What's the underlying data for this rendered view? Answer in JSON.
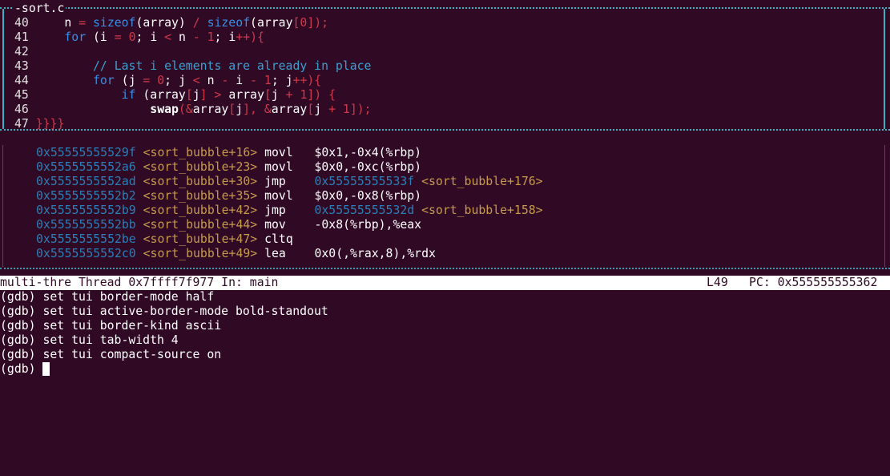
{
  "source_window": {
    "title": "sort.c",
    "lines": [
      {
        "num": "40",
        "tokens": [
          {
            "t": "    n ",
            "c": "c-text"
          },
          {
            "t": "= ",
            "c": "c-red"
          },
          {
            "t": "sizeof",
            "c": "c-kw"
          },
          {
            "t": "(array) ",
            "c": "c-text"
          },
          {
            "t": "/ ",
            "c": "c-red"
          },
          {
            "t": "sizeof",
            "c": "c-kw"
          },
          {
            "t": "(array",
            "c": "c-text"
          },
          {
            "t": "[",
            "c": "c-red"
          },
          {
            "t": "0",
            "c": "c-red"
          },
          {
            "t": "]",
            "c": "c-red"
          },
          {
            "t": ");",
            "c": "c-red"
          }
        ]
      },
      {
        "num": "41",
        "tokens": [
          {
            "t": "    ",
            "c": "c-text"
          },
          {
            "t": "for",
            "c": "c-kw"
          },
          {
            "t": " (i ",
            "c": "c-text"
          },
          {
            "t": "= ",
            "c": "c-red"
          },
          {
            "t": "0",
            "c": "c-red"
          },
          {
            "t": "; i ",
            "c": "c-text"
          },
          {
            "t": "< ",
            "c": "c-red"
          },
          {
            "t": "n ",
            "c": "c-text"
          },
          {
            "t": "- ",
            "c": "c-red"
          },
          {
            "t": "1",
            "c": "c-red"
          },
          {
            "t": "; i",
            "c": "c-text"
          },
          {
            "t": "++){",
            "c": "c-red"
          }
        ]
      },
      {
        "num": "42",
        "tokens": []
      },
      {
        "num": "43",
        "tokens": [
          {
            "t": "        // Last i elements are already in place",
            "c": "c-cmt"
          }
        ]
      },
      {
        "num": "44",
        "tokens": [
          {
            "t": "        ",
            "c": "c-text"
          },
          {
            "t": "for",
            "c": "c-kw"
          },
          {
            "t": " (j ",
            "c": "c-text"
          },
          {
            "t": "= ",
            "c": "c-red"
          },
          {
            "t": "0",
            "c": "c-red"
          },
          {
            "t": "; j ",
            "c": "c-text"
          },
          {
            "t": "< ",
            "c": "c-red"
          },
          {
            "t": "n ",
            "c": "c-text"
          },
          {
            "t": "- ",
            "c": "c-red"
          },
          {
            "t": "i ",
            "c": "c-text"
          },
          {
            "t": "- ",
            "c": "c-red"
          },
          {
            "t": "1",
            "c": "c-red"
          },
          {
            "t": "; j",
            "c": "c-text"
          },
          {
            "t": "++){",
            "c": "c-red"
          }
        ]
      },
      {
        "num": "45",
        "tokens": [
          {
            "t": "            ",
            "c": "c-text"
          },
          {
            "t": "if",
            "c": "c-kw"
          },
          {
            "t": " (array",
            "c": "c-text"
          },
          {
            "t": "[",
            "c": "c-red"
          },
          {
            "t": "j",
            "c": "c-text"
          },
          {
            "t": "] ",
            "c": "c-red"
          },
          {
            "t": "> ",
            "c": "c-red"
          },
          {
            "t": "array",
            "c": "c-text"
          },
          {
            "t": "[",
            "c": "c-red"
          },
          {
            "t": "j ",
            "c": "c-text"
          },
          {
            "t": "+ ",
            "c": "c-red"
          },
          {
            "t": "1",
            "c": "c-red"
          },
          {
            "t": "]) {",
            "c": "c-red"
          }
        ]
      },
      {
        "num": "46",
        "tokens": [
          {
            "t": "                ",
            "c": "c-text"
          },
          {
            "t": "swap",
            "c": "c-bold"
          },
          {
            "t": "(&",
            "c": "c-red"
          },
          {
            "t": "array",
            "c": "c-text"
          },
          {
            "t": "[",
            "c": "c-red"
          },
          {
            "t": "j",
            "c": "c-text"
          },
          {
            "t": "], &",
            "c": "c-red"
          },
          {
            "t": "array",
            "c": "c-text"
          },
          {
            "t": "[",
            "c": "c-red"
          },
          {
            "t": "j ",
            "c": "c-text"
          },
          {
            "t": "+ ",
            "c": "c-red"
          },
          {
            "t": "1",
            "c": "c-red"
          },
          {
            "t": "]);",
            "c": "c-red"
          }
        ]
      },
      {
        "num": "47",
        "tokens": [
          {
            "t": "}}}}",
            "c": "c-red"
          }
        ]
      }
    ]
  },
  "asm_window": {
    "lines": [
      {
        "addr": "0x55555555529f",
        "sym": "<sort_bubble+16>",
        "op": "movl",
        "args": "$0x1,-0x4(%rbp)",
        "target_addr": "",
        "target_sym": ""
      },
      {
        "addr": "0x5555555552a6",
        "sym": "<sort_bubble+23>",
        "op": "movl",
        "args": "$0x0,-0xc(%rbp)",
        "target_addr": "",
        "target_sym": ""
      },
      {
        "addr": "0x5555555552ad",
        "sym": "<sort_bubble+30>",
        "op": "jmp",
        "args": "",
        "target_addr": "0x55555555533f",
        "target_sym": "<sort_bubble+176>"
      },
      {
        "addr": "0x5555555552b2",
        "sym": "<sort_bubble+35>",
        "op": "movl",
        "args": "$0x0,-0x8(%rbp)",
        "target_addr": "",
        "target_sym": ""
      },
      {
        "addr": "0x5555555552b9",
        "sym": "<sort_bubble+42>",
        "op": "jmp",
        "args": "",
        "target_addr": "0x55555555532d",
        "target_sym": "<sort_bubble+158>"
      },
      {
        "addr": "0x5555555552bb",
        "sym": "<sort_bubble+44>",
        "op": "mov",
        "args": "-0x8(%rbp),%eax",
        "target_addr": "",
        "target_sym": ""
      },
      {
        "addr": "0x5555555552be",
        "sym": "<sort_bubble+47>",
        "op": "cltq",
        "args": "",
        "target_addr": "",
        "target_sym": ""
      },
      {
        "addr": "0x5555555552c0",
        "sym": "<sort_bubble+49>",
        "op": "lea",
        "args": "0x0(,%rax,8),%rdx",
        "target_addr": "",
        "target_sym": ""
      }
    ]
  },
  "status_bar": {
    "process": "multi-thre Thread 0x7ffff7f977 In: main",
    "line": "L49",
    "pc": "PC: 0x555555555362"
  },
  "console": {
    "prompt": "(gdb) ",
    "history": [
      "set tui border-mode half",
      "set tui active-border-mode bold-standout",
      "set tui border-kind ascii",
      "set tui tab-width 4",
      "set tui compact-source on"
    ],
    "current_input": ""
  },
  "colors": {
    "background": "#300a24",
    "border_active": "#34b3c3",
    "keyword": "#3a8ee6",
    "operator": "#d0384a",
    "address": "#2a7fb8",
    "symbol": "#c79a4c"
  }
}
